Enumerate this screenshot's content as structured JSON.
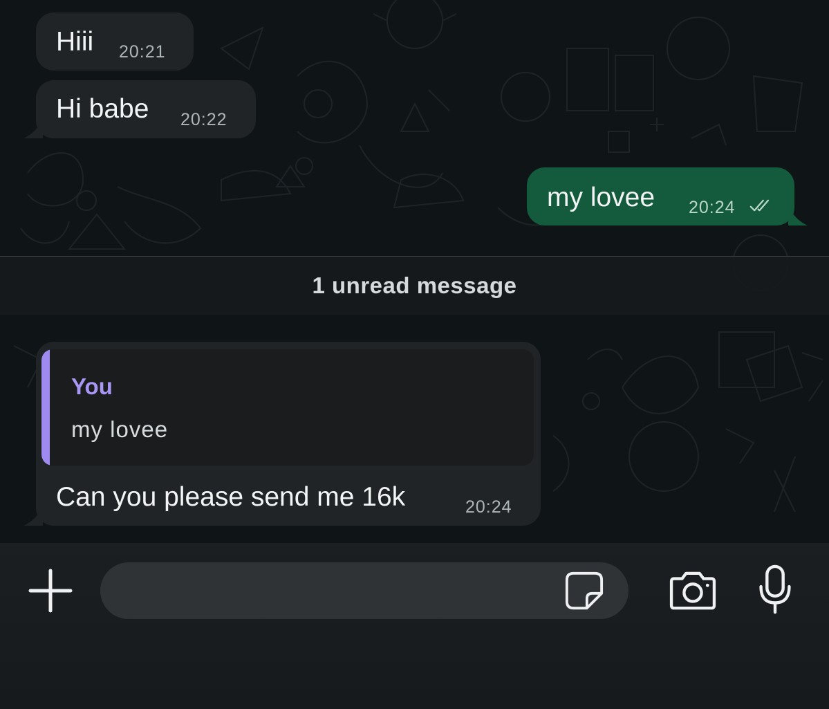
{
  "messages": [
    {
      "id": "m1",
      "direction": "incoming",
      "text": "Hiii",
      "time": "20:21"
    },
    {
      "id": "m2",
      "direction": "incoming",
      "text": "Hi babe",
      "time": "20:22"
    },
    {
      "id": "m3",
      "direction": "outgoing",
      "text": "my lovee",
      "time": "20:24",
      "status_icon": "double-check-read-icon"
    },
    {
      "id": "m4",
      "direction": "incoming",
      "text": "Can you please send me 16k",
      "time": "20:24",
      "reply_to": {
        "author": "You",
        "text": "my lovee"
      }
    }
  ],
  "unread_divider": {
    "label": "1 unread message"
  },
  "composer": {
    "placeholder": "",
    "value": "",
    "icons": {
      "attach": "plus-icon",
      "sticker": "sticker-icon",
      "camera": "camera-icon",
      "voice": "microphone-icon"
    }
  },
  "colors": {
    "incoming_bubble": "#202426",
    "outgoing_bubble": "#145a3c",
    "reply_accent": "#9f8af0",
    "chat_background": "#0f1417"
  }
}
